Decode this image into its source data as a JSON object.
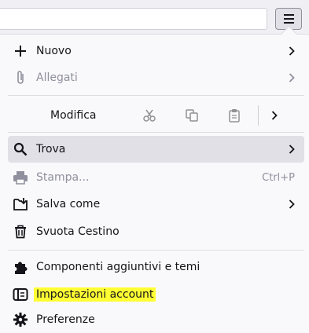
{
  "menu": {
    "new": {
      "label": "Nuovo",
      "icon": "plus-icon"
    },
    "attachments": {
      "label": "Allegati",
      "icon": "paperclip-icon"
    },
    "edit": {
      "label": "Modifica",
      "cut_icon": "scissors-icon",
      "copy_icon": "copy-icon",
      "paste_icon": "clipboard-icon"
    },
    "find": {
      "label": "Trova",
      "icon": "magnifier-icon"
    },
    "print": {
      "label": "Stampa...",
      "shortcut": "Ctrl+P",
      "icon": "printer-icon"
    },
    "save_as": {
      "label": "Salva come",
      "icon": "save-folder-icon"
    },
    "empty_trash": {
      "label": "Svuota Cestino",
      "icon": "trash-icon"
    },
    "addons": {
      "label": "Componenti aggiuntivi e temi",
      "icon": "puzzle-icon"
    },
    "account_settings": {
      "label": "Impostazioni account",
      "icon": "account-card-icon",
      "highlight_color": "#ffff33"
    },
    "preferences": {
      "label": "Preferenze",
      "icon": "gear-icon"
    }
  }
}
